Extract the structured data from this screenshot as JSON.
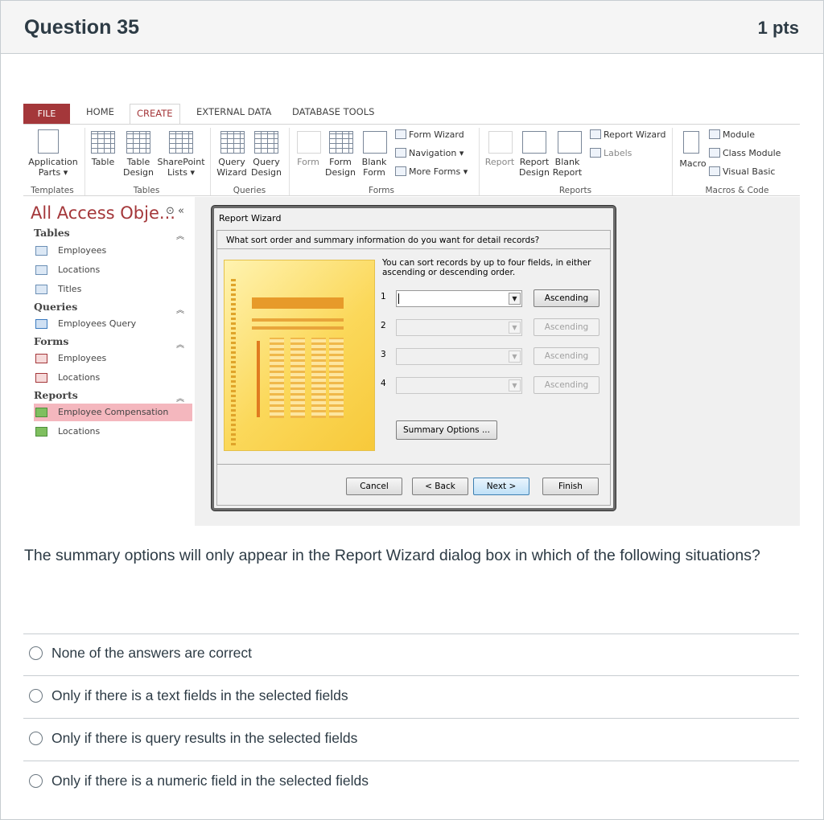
{
  "question": {
    "title": "Question 35",
    "points": "1 pts",
    "text": "The summary options will only appear in the Report Wizard dialog box in which of the following situations?",
    "answers": [
      "None of the answers are correct",
      "Only if there is a text fields in the selected fields",
      "Only if there is query results in the selected fields",
      "Only if there is a numeric field in the selected fields"
    ]
  },
  "ribbon": {
    "tabs": [
      "FILE",
      "HOME",
      "CREATE",
      "EXTERNAL DATA",
      "DATABASE TOOLS"
    ],
    "active_tab": "CREATE",
    "buttons": {
      "application_parts": [
        "Application",
        "Parts ▾"
      ],
      "table": "Table",
      "table_design": [
        "Table",
        "Design"
      ],
      "sharepoint_lists": [
        "SharePoint",
        "Lists ▾"
      ],
      "query_wizard": [
        "Query",
        "Wizard"
      ],
      "query_design": [
        "Query",
        "Design"
      ],
      "form": "Form",
      "form_design": [
        "Form",
        "Design"
      ],
      "blank_form": [
        "Blank",
        "Form"
      ],
      "form_wizard": "Form Wizard",
      "navigation": "Navigation ▾",
      "more_forms": "More Forms ▾",
      "report": "Report",
      "report_design": [
        "Report",
        "Design"
      ],
      "blank_report": [
        "Blank",
        "Report"
      ],
      "report_wizard": "Report Wizard",
      "labels": "Labels",
      "macro": "Macro",
      "module": "Module",
      "class_module": "Class Module",
      "visual_basic": "Visual Basic"
    },
    "groups": [
      "Templates",
      "Tables",
      "Queries",
      "Forms",
      "Reports",
      "Macros & Code"
    ]
  },
  "nav_pane": {
    "title": "All Access Obje...",
    "sections": [
      {
        "name": "Tables",
        "items": [
          "Employees",
          "Locations",
          "Titles"
        ]
      },
      {
        "name": "Queries",
        "items": [
          "Employees Query"
        ]
      },
      {
        "name": "Forms",
        "items": [
          "Employees",
          "Locations"
        ]
      },
      {
        "name": "Reports",
        "items": [
          "Employee Compensation",
          "Locations"
        ]
      }
    ],
    "selected_item": "Employee Compensation"
  },
  "wizard": {
    "title": "Report Wizard",
    "question": "What sort order and summary information do you want for detail records?",
    "instructions": "You can sort records by up to four fields, in either ascending or descending order.",
    "sort_rows": [
      {
        "num": "1",
        "value": "",
        "order": "Ascending",
        "enabled": true
      },
      {
        "num": "2",
        "value": "",
        "order": "Ascending",
        "enabled": false
      },
      {
        "num": "3",
        "value": "",
        "order": "Ascending",
        "enabled": false
      },
      {
        "num": "4",
        "value": "",
        "order": "Ascending",
        "enabled": false
      }
    ],
    "summary_button": "Summary Options ...",
    "buttons": {
      "cancel": "Cancel",
      "back": "< Back",
      "next": "Next >",
      "finish": "Finish"
    }
  }
}
